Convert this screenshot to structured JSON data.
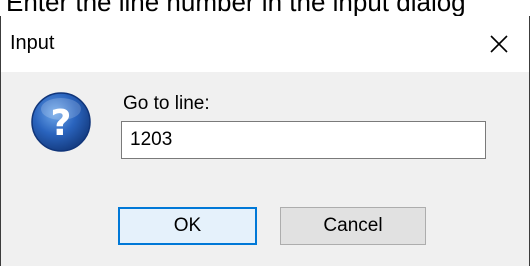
{
  "instruction": "Enter the line number in the input dialog",
  "dialog": {
    "title": "Input",
    "close_icon": "close-icon",
    "question_icon": "question-icon",
    "prompt": "Go to line:",
    "input_value": "1203",
    "ok_label": "OK",
    "cancel_label": "Cancel"
  },
  "colors": {
    "icon_blue": "#1f5fb0",
    "focus_border": "#0078d7",
    "dialog_background": "#f0f0f0"
  }
}
